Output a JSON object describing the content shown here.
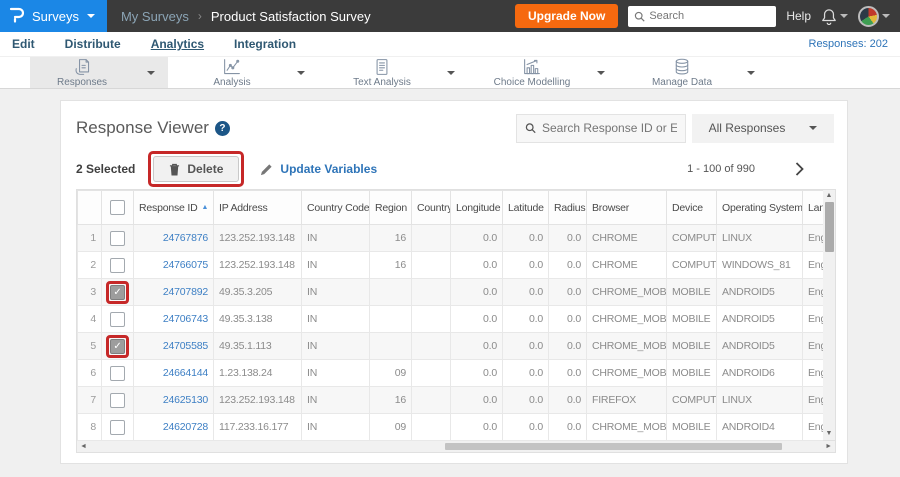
{
  "header": {
    "brand_menu_label": "Surveys",
    "breadcrumb_parent": "My Surveys",
    "breadcrumb_separator": "›",
    "page_title": "Product Satisfaction Survey",
    "upgrade_button_label": "Upgrade Now",
    "search_placeholder": "Search",
    "help_label": "Help",
    "brand_color": "#1b87e6",
    "bar_color": "#3b3b3b",
    "upgrade_color": "#f6690f"
  },
  "nav": {
    "items": [
      "Edit",
      "Distribute",
      "Analytics",
      "Integration"
    ],
    "active_item": "Analytics",
    "responses_link": "Responses: 202"
  },
  "toolbar": {
    "tabs": [
      {
        "label": "Responses",
        "icon": "responses-icon",
        "active": true
      },
      {
        "label": "Analysis",
        "icon": "analysis-icon",
        "active": false
      },
      {
        "label": "Text Analysis",
        "icon": "text-analysis-icon",
        "active": false
      },
      {
        "label": "Choice Modelling",
        "icon": "choice-modelling-icon",
        "active": false
      },
      {
        "label": "Manage Data",
        "icon": "manage-data-icon",
        "active": false
      }
    ]
  },
  "viewer": {
    "title": "Response Viewer",
    "help_icon": "?",
    "search_placeholder": "Search Response ID or Email",
    "filter_selected": "All Responses",
    "selected_count_label": "2 Selected",
    "delete_button_label": "Delete",
    "update_variables_label": "Update Variables",
    "pagination_label": "1 - 100 of 990"
  },
  "table": {
    "columns": [
      "",
      "",
      "Response ID",
      "IP Address",
      "Country Code",
      "Region",
      "Country",
      "Longitude",
      "Latitude",
      "Radius",
      "Browser",
      "Device",
      "Operating System",
      "Language"
    ],
    "sorted_column": "Response ID",
    "sort_direction": "asc",
    "rows": [
      {
        "num": "1",
        "checked": false,
        "annotated": false,
        "response_id": "24767876",
        "ip_address": "123.252.193.148",
        "country_code": "IN",
        "region": "16",
        "country": "",
        "longitude": "0.0",
        "latitude": "0.0",
        "radius": "0.0",
        "browser": "CHROME",
        "device": "COMPUTER",
        "operating_system": "LINUX",
        "language": "English"
      },
      {
        "num": "2",
        "checked": false,
        "annotated": false,
        "response_id": "24766075",
        "ip_address": "123.252.193.148",
        "country_code": "IN",
        "region": "16",
        "country": "",
        "longitude": "0.0",
        "latitude": "0.0",
        "radius": "0.0",
        "browser": "CHROME",
        "device": "COMPUTER",
        "operating_system": "WINDOWS_81",
        "language": "English"
      },
      {
        "num": "3",
        "checked": true,
        "annotated": true,
        "response_id": "24707892",
        "ip_address": "49.35.3.205",
        "country_code": "IN",
        "region": "",
        "country": "",
        "longitude": "0.0",
        "latitude": "0.0",
        "radius": "0.0",
        "browser": "CHROME_MOBILE",
        "device": "MOBILE",
        "operating_system": "ANDROID5",
        "language": "English"
      },
      {
        "num": "4",
        "checked": false,
        "annotated": false,
        "response_id": "24706743",
        "ip_address": "49.35.3.138",
        "country_code": "IN",
        "region": "",
        "country": "",
        "longitude": "0.0",
        "latitude": "0.0",
        "radius": "0.0",
        "browser": "CHROME_MOBILE",
        "device": "MOBILE",
        "operating_system": "ANDROID5",
        "language": "English"
      },
      {
        "num": "5",
        "checked": true,
        "annotated": true,
        "response_id": "24705585",
        "ip_address": "49.35.1.113",
        "country_code": "IN",
        "region": "",
        "country": "",
        "longitude": "0.0",
        "latitude": "0.0",
        "radius": "0.0",
        "browser": "CHROME_MOBILE",
        "device": "MOBILE",
        "operating_system": "ANDROID5",
        "language": "English"
      },
      {
        "num": "6",
        "checked": false,
        "annotated": false,
        "response_id": "24664144",
        "ip_address": "1.23.138.24",
        "country_code": "IN",
        "region": "09",
        "country": "",
        "longitude": "0.0",
        "latitude": "0.0",
        "radius": "0.0",
        "browser": "CHROME_MOBILE",
        "device": "MOBILE",
        "operating_system": "ANDROID6",
        "language": "English"
      },
      {
        "num": "7",
        "checked": false,
        "annotated": false,
        "response_id": "24625130",
        "ip_address": "123.252.193.148",
        "country_code": "IN",
        "region": "16",
        "country": "",
        "longitude": "0.0",
        "latitude": "0.0",
        "radius": "0.0",
        "browser": "FIREFOX",
        "device": "COMPUTER",
        "operating_system": "LINUX",
        "language": "English"
      },
      {
        "num": "8",
        "checked": false,
        "annotated": false,
        "response_id": "24620728",
        "ip_address": "117.233.16.177",
        "country_code": "IN",
        "region": "09",
        "country": "",
        "longitude": "0.0",
        "latitude": "0.0",
        "radius": "0.0",
        "browser": "CHROME_MOBILE",
        "device": "MOBILE",
        "operating_system": "ANDROID4",
        "language": "English"
      }
    ]
  },
  "annotations": {
    "color": "#c62828",
    "highlighted": [
      "delete-button",
      "row-3-checkbox",
      "row-5-checkbox"
    ]
  }
}
